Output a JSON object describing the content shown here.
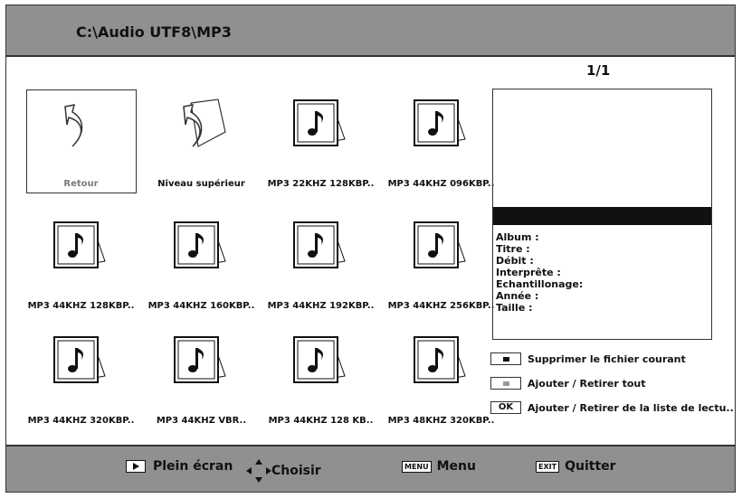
{
  "header": {
    "path": "C:\\Audio UTF8\\MP3"
  },
  "pager": "1/1",
  "tiles": [
    {
      "label": "Retour",
      "icon": "return-folder-icon"
    },
    {
      "label": "Niveau supérieur",
      "icon": "parent-folder-icon"
    },
    {
      "label": "MP3 22KHZ 128KBP..",
      "icon": "music-file-icon"
    },
    {
      "label": "MP3 44KHZ 096KBP..",
      "icon": "music-file-icon"
    },
    {
      "label": "MP3 44KHZ 128KBP..",
      "icon": "music-file-icon"
    },
    {
      "label": "MP3 44KHZ 160KBP..",
      "icon": "music-file-icon"
    },
    {
      "label": "MP3 44KHZ 192KBP..",
      "icon": "music-file-icon"
    },
    {
      "label": "MP3 44KHZ 256KBP..",
      "icon": "music-file-icon"
    },
    {
      "label": "MP3 44KHZ 320KBP..",
      "icon": "music-file-icon"
    },
    {
      "label": "MP3 44KHZ VBR..",
      "icon": "music-file-icon"
    },
    {
      "label": "MP3 44KHZ 128 KB..",
      "icon": "music-file-icon"
    },
    {
      "label": "MP3 48KHZ 320KBP..",
      "icon": "music-file-icon"
    }
  ],
  "info": {
    "album": "Album :",
    "titre": "Titre :",
    "debit": "Débit :",
    "interprete": "Interprête :",
    "echantillonage": "Echantillonage:",
    "annee": "Année :",
    "taille": "Taille :"
  },
  "legend": {
    "delete": "Supprimer le fichier courant",
    "toggle_all": "Ajouter / Retirer tout",
    "ok_key": "OK",
    "toggle_playlist": "Ajouter / Retirer de la liste de lectu.."
  },
  "footer": {
    "fullscreen": "Plein écran",
    "choose": "Choisir",
    "menu_key": "MENU",
    "menu": "Menu",
    "exit_key": "EXIT",
    "quit": "Quitter"
  }
}
